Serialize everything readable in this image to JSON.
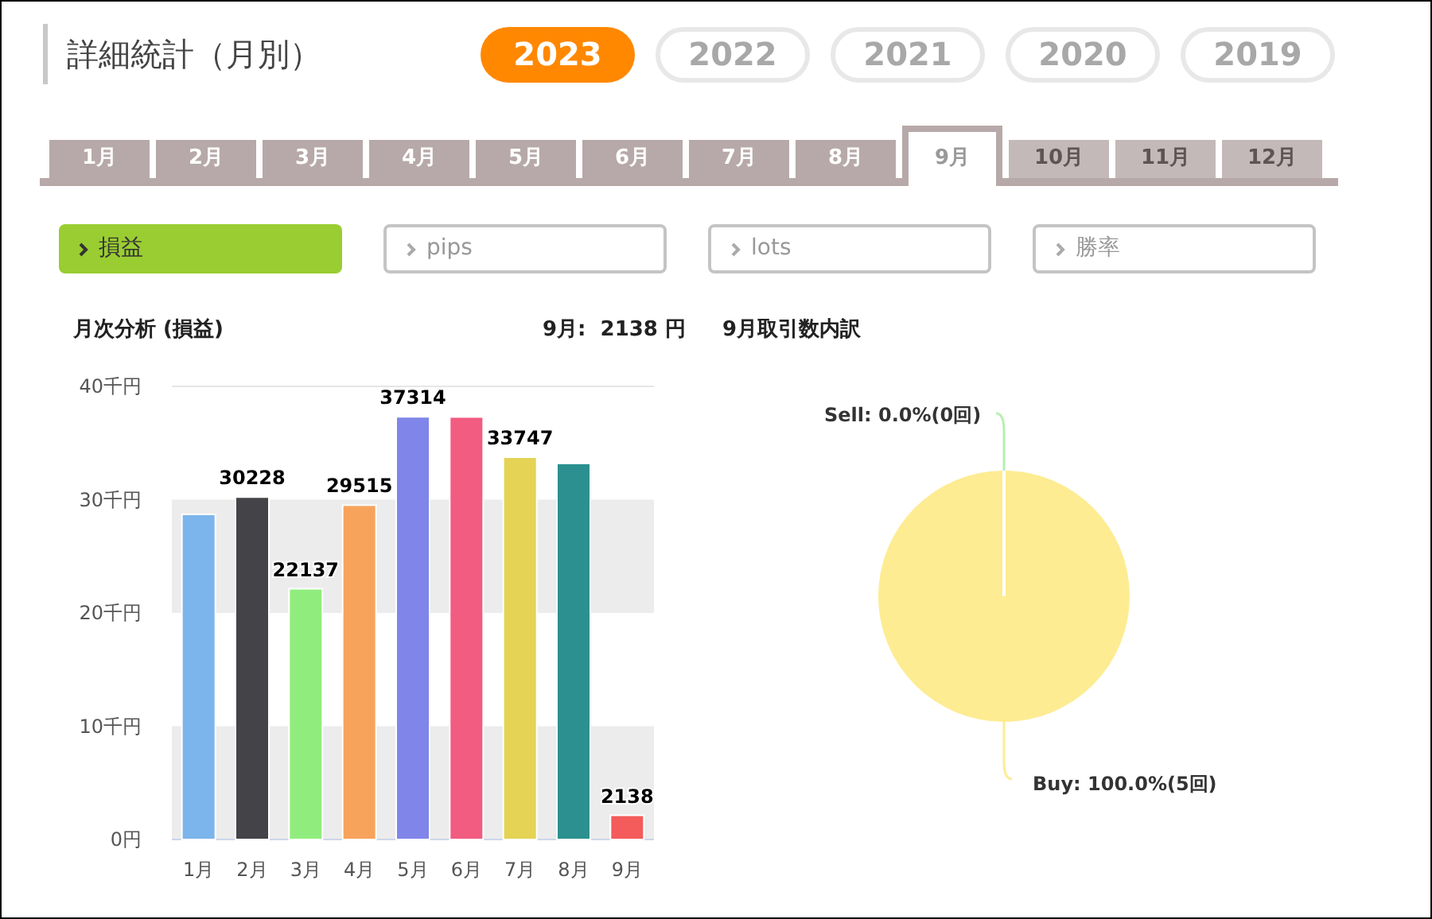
{
  "title": "詳細統計（月別）",
  "years": [
    {
      "label": "2023",
      "selected": true
    },
    {
      "label": "2022",
      "selected": false
    },
    {
      "label": "2021",
      "selected": false
    },
    {
      "label": "2020",
      "selected": false
    },
    {
      "label": "2019",
      "selected": false
    }
  ],
  "month_tabs": [
    {
      "label": "1月",
      "selected": false,
      "disabled": false
    },
    {
      "label": "2月",
      "selected": false,
      "disabled": false
    },
    {
      "label": "3月",
      "selected": false,
      "disabled": false
    },
    {
      "label": "4月",
      "selected": false,
      "disabled": false
    },
    {
      "label": "5月",
      "selected": false,
      "disabled": false
    },
    {
      "label": "6月",
      "selected": false,
      "disabled": false
    },
    {
      "label": "7月",
      "selected": false,
      "disabled": false
    },
    {
      "label": "8月",
      "selected": false,
      "disabled": false
    },
    {
      "label": "9月",
      "selected": true,
      "disabled": false
    },
    {
      "label": "10月",
      "selected": false,
      "disabled": true
    },
    {
      "label": "11月",
      "selected": false,
      "disabled": true
    },
    {
      "label": "12月",
      "selected": false,
      "disabled": true
    }
  ],
  "metrics": [
    {
      "label": "損益",
      "selected": true
    },
    {
      "label": "pips",
      "selected": false
    },
    {
      "label": "lots",
      "selected": false
    },
    {
      "label": "勝率",
      "selected": false
    }
  ],
  "monthly": {
    "title": "月次分析 (損益)",
    "summary": "9月:  2138 円",
    "chart_data": {
      "type": "bar",
      "categories": [
        "1月",
        "2月",
        "3月",
        "4月",
        "5月",
        "6月",
        "7月",
        "8月",
        "9月"
      ],
      "values": [
        28.7,
        30.228,
        22.137,
        29.515,
        37.314,
        37.3,
        33.747,
        33.2,
        2.138
      ],
      "colors": [
        "#7cb5ec",
        "#434348",
        "#90ed7d",
        "#f7a35c",
        "#8085e9",
        "#f15c80",
        "#e4d354",
        "#2b908f",
        "#f45b5b"
      ],
      "annotations": [
        null,
        "30228",
        "22137",
        "29515",
        "37314",
        null,
        "33747",
        null,
        "2138"
      ],
      "ylim": [
        0,
        40
      ],
      "yticks": [
        {
          "value": 0,
          "label": "0円"
        },
        {
          "value": 10,
          "label": "10千円"
        },
        {
          "value": 20,
          "label": "20千円"
        },
        {
          "value": 30,
          "label": "30千円"
        },
        {
          "value": 40,
          "label": "40千円"
        }
      ]
    }
  },
  "breakdown": {
    "title": "9月取引数内訳",
    "chart_data": {
      "type": "pie",
      "values": [
        0,
        5
      ],
      "colors": [
        "#b6f0b0",
        "#fdec92"
      ],
      "value_labels": [
        "Sell: 0.0%(0回)",
        "Buy: 100.0%(5回)"
      ]
    }
  }
}
